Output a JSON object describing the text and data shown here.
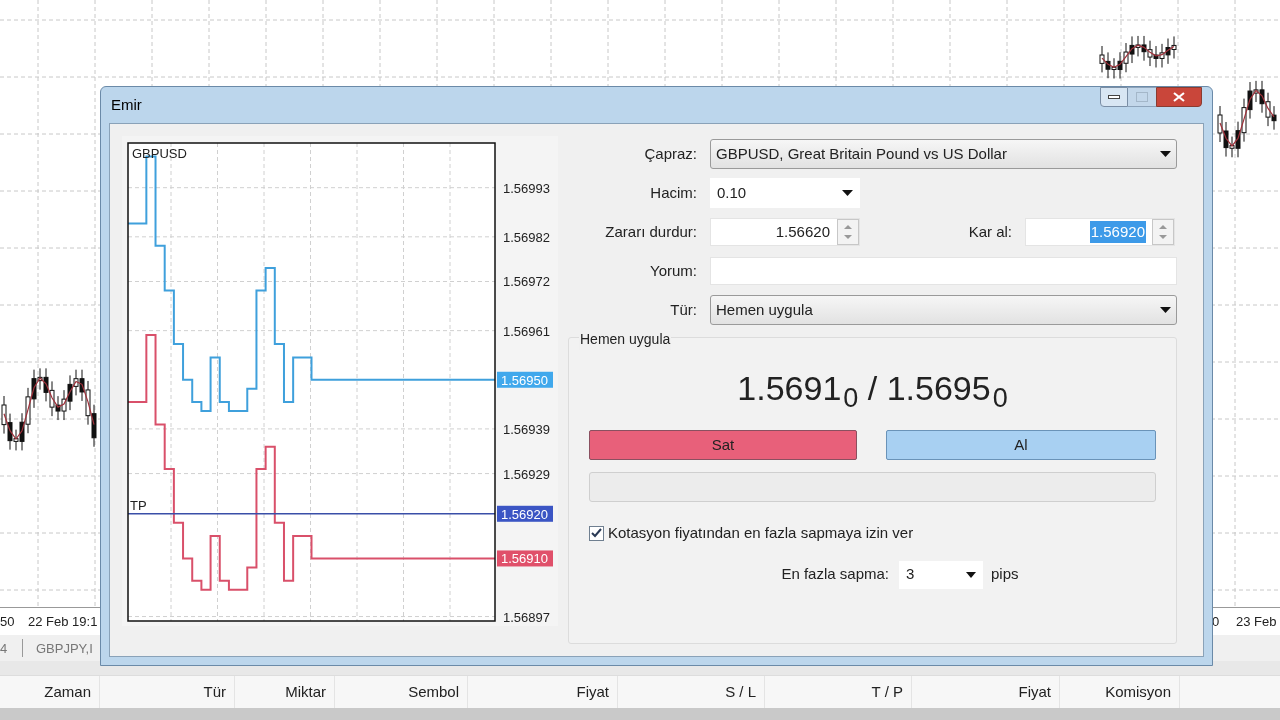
{
  "background": {
    "time_labels": [
      "50",
      "22 Feb 19:1",
      "0",
      "23 Feb"
    ],
    "tabs": [
      "4",
      "GBPJPY,I"
    ],
    "columns": [
      "Zaman",
      "Tür",
      "Miktar",
      "Sembol",
      "Fiyat",
      "S / L",
      "T / P",
      "Fiyat",
      "Komisyon"
    ]
  },
  "dialog": {
    "title": "Emir",
    "maximize_disabled": true,
    "chart": {
      "symbol": "GBPUSD",
      "line_label": "TP",
      "axis_labels": [
        "1.56993",
        "1.56982",
        "1.56972",
        "1.56961",
        "1.56939",
        "1.56929",
        "1.56897"
      ],
      "price_tags": [
        {
          "text": "1.56950",
          "color": "#40a8ec"
        },
        {
          "text": "1.56920",
          "color": "#3b55c4"
        },
        {
          "text": "1.56910",
          "color": "#e0506a"
        }
      ]
    },
    "form": {
      "symbol": {
        "label": "Çapraz:",
        "value": "GBPUSD, Great Britain Pound vs US Dollar"
      },
      "volume": {
        "label": "Hacim:",
        "value": "0.10"
      },
      "stop_loss": {
        "label": "Zararı durdur:",
        "value": "1.56620"
      },
      "take_profit": {
        "label": "Kar al:",
        "value": "1.56920",
        "text_selected": true
      },
      "comment": {
        "label": "Yorum:"
      },
      "type": {
        "label": "Tür:",
        "value": "Hemen uygula"
      }
    },
    "execution": {
      "title": "Hemen uygula",
      "quote": "1.5691$_{0}$ / 1.5695$_{0}$",
      "sell_button": "Sat",
      "buy_button": "Al",
      "deviation": {
        "label": "Kotasyon fiyatından en fazla sapmaya izin ver",
        "checked": true
      },
      "max_deviation": {
        "label": "En fazla sapma:",
        "value": "3",
        "unit": "pips"
      }
    }
  }
}
